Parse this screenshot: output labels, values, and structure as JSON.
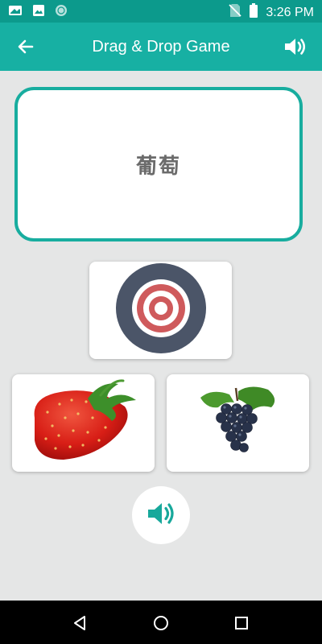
{
  "status_bar": {
    "time": "3:26 PM",
    "left_icons": [
      "notification-icon",
      "image-icon",
      "sync-icon"
    ],
    "right_icons": [
      "no-sim-icon",
      "battery-icon"
    ]
  },
  "app_bar": {
    "title": "Drag & Drop Game",
    "back_icon": "arrow-left-icon",
    "audio_icon": "speaker-icon"
  },
  "word_card": {
    "word": "葡萄"
  },
  "drop_target": {
    "icon": "target-icon"
  },
  "options": [
    {
      "name": "strawberry",
      "icon": "strawberry-image"
    },
    {
      "name": "grapes",
      "icon": "grapes-image"
    }
  ],
  "play_sound_button": {
    "icon": "speaker-icon"
  },
  "nav_bar": {
    "items": [
      "back-icon",
      "home-icon",
      "recents-icon"
    ]
  },
  "colors": {
    "primary": "#17b0a3",
    "primary_dark": "#0c9a8c",
    "background": "#e5e6e6",
    "target_ring": "#4b5568",
    "target_red": "#cf5a5c"
  }
}
